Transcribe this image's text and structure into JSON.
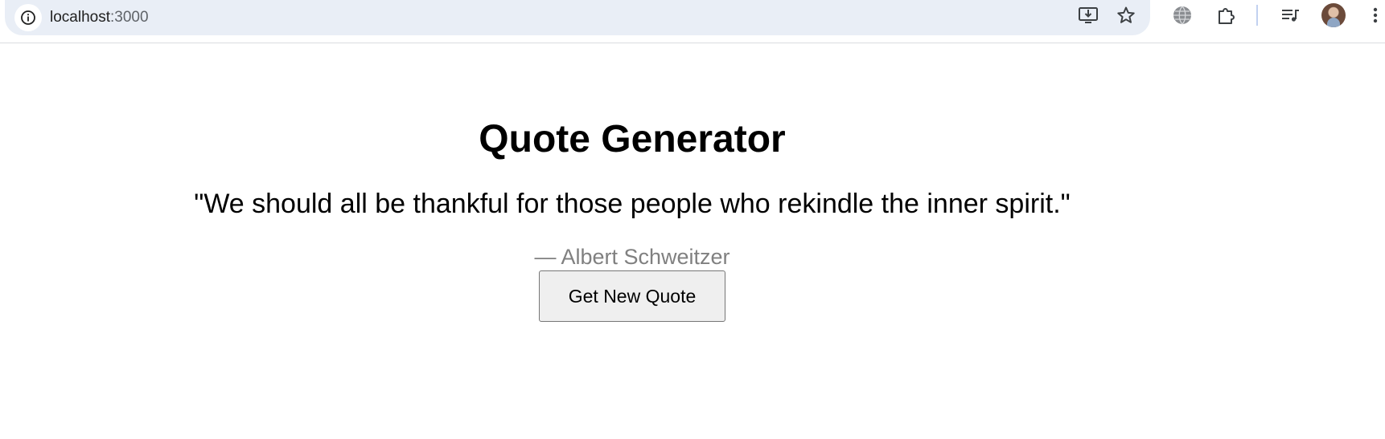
{
  "browser": {
    "url_host": "localhost",
    "url_port": ":3000",
    "icons": {
      "site_info": "info-icon",
      "install": "install-app-icon",
      "bookmark": "star-icon",
      "translate": "globe-icon",
      "extensions": "puzzle-icon",
      "media": "media-queue-icon",
      "profile": "avatar",
      "menu": "more-vert-icon"
    }
  },
  "page": {
    "title": "Quote Generator",
    "quote": "\"We should all be thankful for those people who rekindle the inner spirit.\"",
    "author": "— Albert Schweitzer",
    "button_label": "Get New Quote"
  },
  "colors": {
    "omnibox_bg": "#e9eef6",
    "author_text": "#808080",
    "button_bg": "#efefef"
  }
}
